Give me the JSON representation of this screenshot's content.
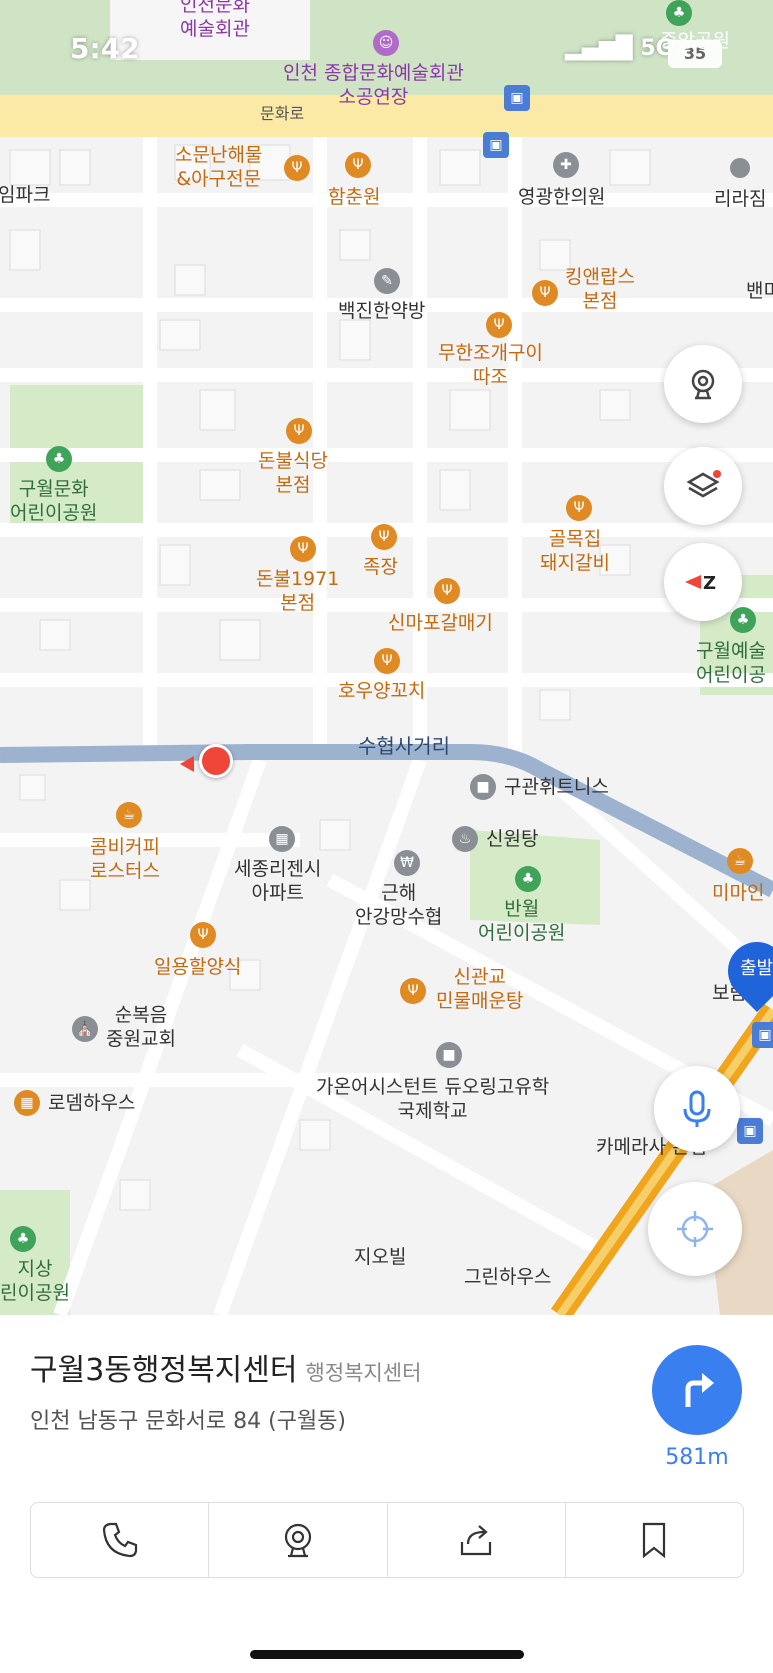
{
  "status_bar": {
    "time": "5:42",
    "network": "5G",
    "battery": "35"
  },
  "map": {
    "road_labels": {
      "munhwa_ro": "문화로",
      "suhyeop_intersection": "수협사거리"
    },
    "pois": {
      "incheon_art_hall_top": "인천문화\n예술회관",
      "incheon_art_hall": "인천 종합문화예술회관\n소공연장",
      "jungang_park": "중앙공원",
      "sumunnan": "소문난해물\n&아구전문",
      "hamchunwon": "함춘원",
      "youngkwang": "영광한의원",
      "rirajim": "리라짐",
      "impark": "임파크",
      "kingnlobs": "킹앤랍스\n본점",
      "baekjin": "백진한약방",
      "muhanjo": "무한조개구이\n따조",
      "baemi": "밴미",
      "guwol_park": "구월문화\n어린이공원",
      "donbul": "돈불식당\n본점",
      "golmok": "골목집\n돼지갈비",
      "jokjang": "족장",
      "donbul1971": "돈불1971\n본점",
      "sinmapo": "신마포갈매기",
      "guwol_art_park": "구월예술\n어린이공",
      "houyang": "호우양꼬치",
      "gugwan": "구관휘트니스",
      "sinwon": "신원탕",
      "kombi": "콤비커피\n로스터스",
      "sejong": "세종리젠시\n아파트",
      "geunhae": "근해\n안강망수협",
      "banwol": "반월\n어린이공원",
      "mimain": "미마인",
      "ilyong": "일용할양식",
      "singwangyo": "신관교\n민물매운탕",
      "sunbok": "순복음\n중원교회",
      "gaon": "가온어시스턴트 듀오링고유학\n국제학교",
      "lodem": "로뎀하우스",
      "camera": "카메라사 본점",
      "jisang": "지상\n린이공원",
      "jiobil": "지오빌",
      "green": "그린하우스",
      "bora": "보람",
      "departure": "출발"
    }
  },
  "place": {
    "name": "구월3동행정복지센터",
    "category": "행정복지센터",
    "address": "인천 남동구 문화서로 84 (구월동)",
    "distance": "581m"
  },
  "actions": [
    "phone-icon",
    "roadview-icon",
    "share-icon",
    "bookmark-icon"
  ],
  "colors": {
    "accent": "#3a7ff0",
    "food": "#e08a23",
    "park": "#3fa35a",
    "main_road": "#f4d36b"
  }
}
